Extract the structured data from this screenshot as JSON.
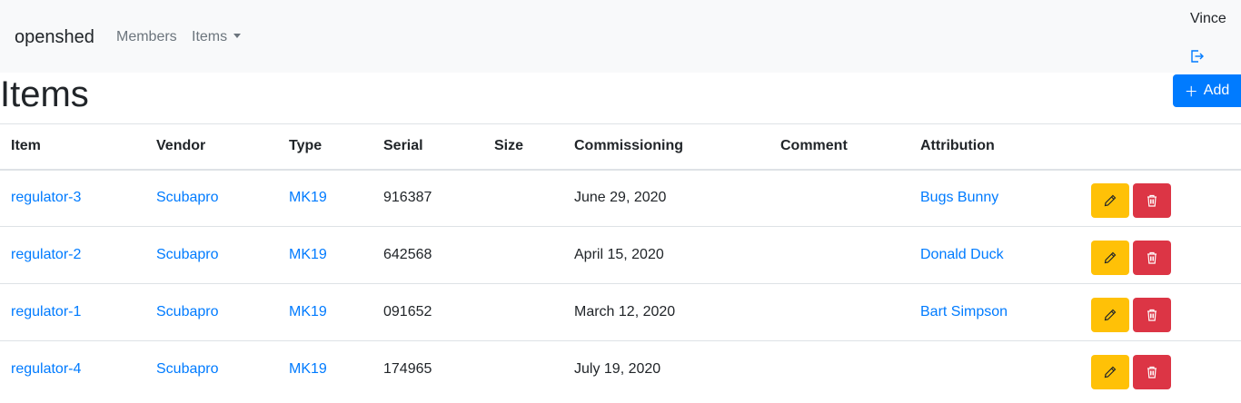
{
  "navbar": {
    "brand": "openshed",
    "links": [
      {
        "label": "Members"
      },
      {
        "label": "Items"
      }
    ],
    "user": "Vince"
  },
  "page": {
    "title": "Items",
    "add_label": "Add"
  },
  "table": {
    "columns": [
      "Item",
      "Vendor",
      "Type",
      "Serial",
      "Size",
      "Commissioning",
      "Comment",
      "Attribution"
    ],
    "rows": [
      {
        "item": "regulator-3",
        "vendor": "Scubapro",
        "type": "MK19",
        "serial": "916387",
        "size": "",
        "commissioning": "June 29, 2020",
        "comment": "",
        "attribution": "Bugs Bunny"
      },
      {
        "item": "regulator-2",
        "vendor": "Scubapro",
        "type": "MK19",
        "serial": "642568",
        "size": "",
        "commissioning": "April 15, 2020",
        "comment": "",
        "attribution": "Donald Duck"
      },
      {
        "item": "regulator-1",
        "vendor": "Scubapro",
        "type": "MK19",
        "serial": "091652",
        "size": "",
        "commissioning": "March 12, 2020",
        "comment": "",
        "attribution": "Bart Simpson"
      },
      {
        "item": "regulator-4",
        "vendor": "Scubapro",
        "type": "MK19",
        "serial": "174965",
        "size": "",
        "commissioning": "July 19, 2020",
        "comment": "",
        "attribution": ""
      }
    ]
  },
  "icons": {
    "logout": "logout-icon",
    "edit": "pencil-icon",
    "delete": "trash-icon",
    "add": "plus-icon"
  },
  "colors": {
    "primary": "#007bff",
    "warning": "#ffc107",
    "danger": "#dc3545",
    "navbar_bg": "#f8f9fa"
  }
}
